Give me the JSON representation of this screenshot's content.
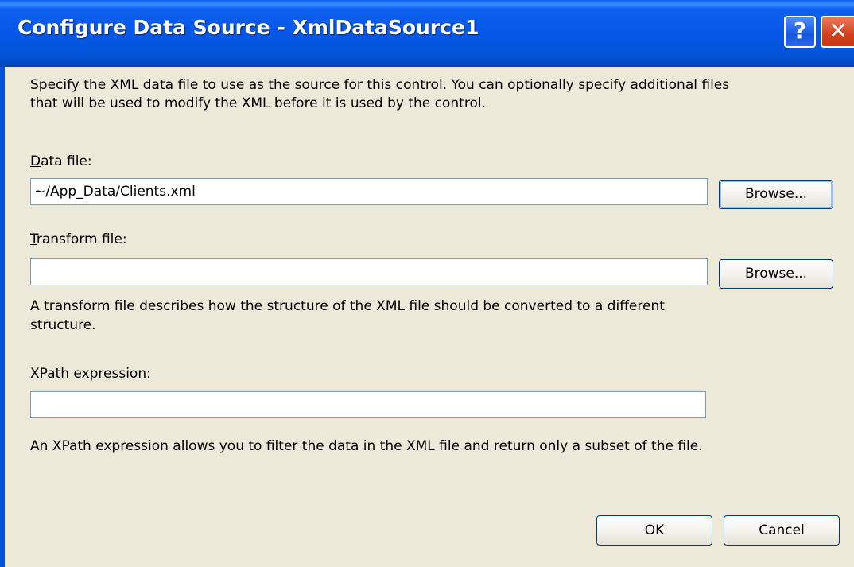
{
  "dialog": {
    "title": "Configure Data Source - XmlDataSource1",
    "help_label": "?",
    "close_label": "✕",
    "description_line1": "Specify the XML data file to use as the source for this control. You can optionally specify additional files",
    "description_line2": "that will be used to modify the XML before it is used by the control."
  },
  "data_file": {
    "label_mnemonic": "D",
    "label_rest": "ata file:",
    "value": "~/App_Data/Clients.xml",
    "browse_label": "Browse..."
  },
  "transform_file": {
    "label_mnemonic": "T",
    "label_rest": "ransform file:",
    "value": "",
    "browse_label": "Browse...",
    "help_line1": "A transform file describes how the structure of the XML file should be converted to a different",
    "help_line2": "structure."
  },
  "xpath": {
    "label_mnemonic": "X",
    "label_rest": "Path expression:",
    "value": "",
    "help_text": "An XPath expression allows you to filter the data in the XML file and return only a subset of the file."
  },
  "buttons": {
    "ok_label": "OK",
    "cancel_label": "Cancel"
  }
}
